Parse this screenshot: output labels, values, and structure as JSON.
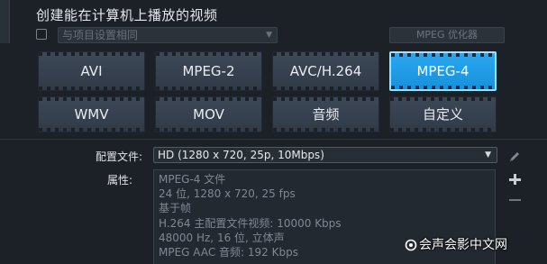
{
  "title": "创建能在计算机上播放的视频",
  "options": {
    "compat_dropdown_value": "与项目设置相同",
    "optimizer_button": "MPEG 优化器"
  },
  "formats": [
    {
      "label": "AVI",
      "active": false
    },
    {
      "label": "MPEG-2",
      "active": false
    },
    {
      "label": "AVC/H.264",
      "active": false
    },
    {
      "label": "MPEG-4",
      "active": true
    },
    {
      "label": "WMV",
      "active": false
    },
    {
      "label": "MOV",
      "active": false
    },
    {
      "label": "音频",
      "active": false
    },
    {
      "label": "自定义",
      "active": false
    }
  ],
  "profile": {
    "label": "配置文件:",
    "value": "HD (1280 x 720, 25p, 10Mbps)"
  },
  "properties": {
    "label": "属性:",
    "lines": [
      "MPEG-4 文件",
      "24 位, 1280 x 720, 25 fps",
      "基于帧",
      "H.264 主配置文件视频: 10000 Kbps",
      "48000 Hz, 16 位, 立体声",
      "MPEG AAC 音频: 192 Kbps"
    ]
  },
  "side_icons": [
    "pencil-icon",
    "plus-icon",
    "minus-icon"
  ],
  "watermark": "会声会影中文网",
  "colors": {
    "background": "#1c2128",
    "button": "#36414f",
    "active_button": "#1e9ae6",
    "active_border": "#9fe0ff"
  }
}
